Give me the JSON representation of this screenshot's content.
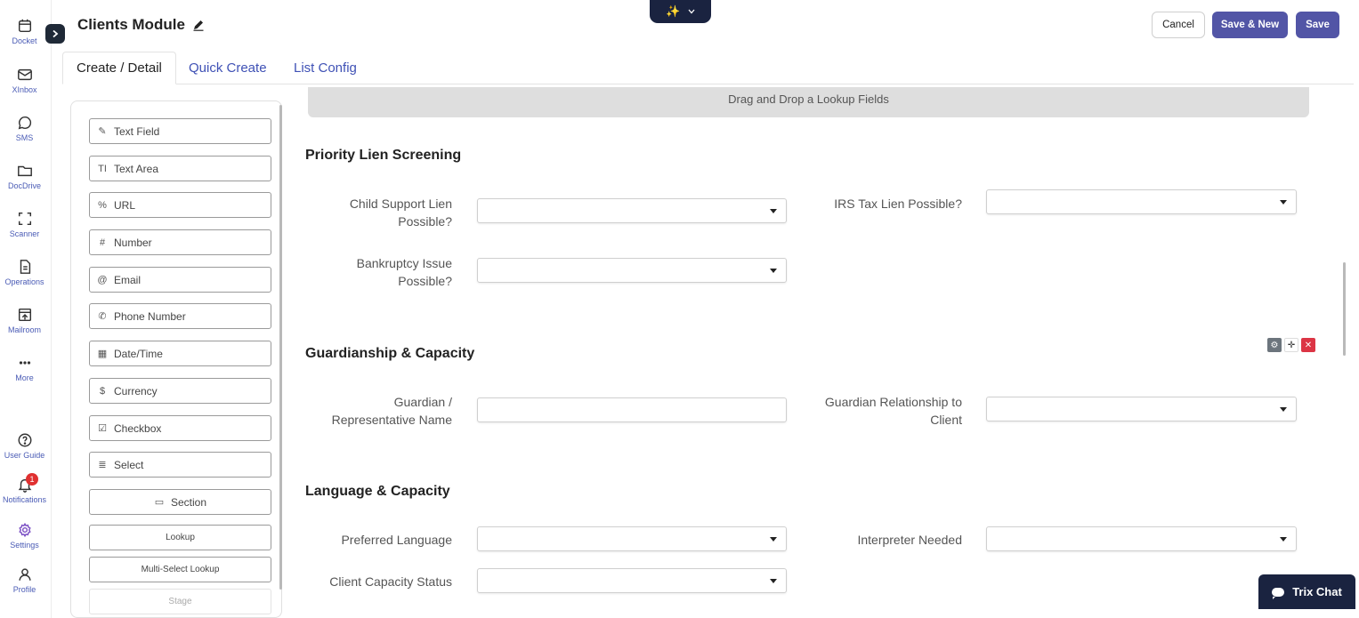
{
  "rail": {
    "items": [
      {
        "label": "Docket",
        "icon": "calendar-icon"
      },
      {
        "label": "XInbox",
        "icon": "mail-icon"
      },
      {
        "label": "SMS",
        "icon": "chat-bubble-icon"
      },
      {
        "label": "DocDrive",
        "icon": "folder-icon"
      },
      {
        "label": "Scanner",
        "icon": "scan-icon"
      },
      {
        "label": "Operations",
        "icon": "document-icon"
      },
      {
        "label": "Mailroom",
        "icon": "mailroom-icon"
      },
      {
        "label": "More",
        "icon": "more-dots-icon"
      }
    ],
    "bottom_items": [
      {
        "label": "User Guide",
        "icon": "help-circle-icon"
      },
      {
        "label": "Notifications",
        "icon": "bell-icon",
        "badge": "1"
      },
      {
        "label": "Settings",
        "icon": "gear-icon"
      },
      {
        "label": "Profile",
        "icon": "user-icon"
      }
    ]
  },
  "header": {
    "title": "Clients Module",
    "magic_icon": "✨",
    "cancel_label": "Cancel",
    "save_new_label": "Save & New",
    "save_label": "Save"
  },
  "tabs": [
    {
      "label": "Create / Detail",
      "active": true
    },
    {
      "label": "Quick Create",
      "active": false
    },
    {
      "label": "List Config",
      "active": false
    }
  ],
  "palette": {
    "items": [
      {
        "label": "Text Field",
        "icon": "✎"
      },
      {
        "label": "Text Area",
        "icon": "TI"
      },
      {
        "label": "URL",
        "icon": "%"
      },
      {
        "label": "Number",
        "icon": "#"
      },
      {
        "label": "Email",
        "icon": "@"
      },
      {
        "label": "Phone Number",
        "icon": "✆"
      },
      {
        "label": "Date/Time",
        "icon": "▦"
      },
      {
        "label": "Currency",
        "icon": "$"
      },
      {
        "label": "Checkbox",
        "icon": "☑"
      },
      {
        "label": "Select",
        "icon": "≣"
      },
      {
        "label": "Section",
        "icon": "▭"
      },
      {
        "label": "Lookup",
        "icon": ""
      },
      {
        "label": "Multi-Select Lookup",
        "icon": ""
      },
      {
        "label": "Stage",
        "icon": ""
      }
    ]
  },
  "form": {
    "dropzone_text": "Drag and Drop a Lookup Fields",
    "sections": [
      {
        "title": "Priority Lien Screening",
        "fields": [
          {
            "label": "Child Support Lien Possible?",
            "type": "select",
            "value": ""
          },
          {
            "label": "IRS Tax Lien Possible?",
            "type": "select",
            "value": ""
          },
          {
            "label": "Bankruptcy Issue Possible?",
            "type": "select",
            "value": ""
          }
        ]
      },
      {
        "title": "Guardianship & Capacity",
        "fields": [
          {
            "label": "Guardian / Representative Name",
            "type": "text",
            "value": ""
          },
          {
            "label": "Guardian Relationship to Client",
            "type": "select",
            "value": ""
          }
        ]
      },
      {
        "title": "Language & Capacity",
        "fields": [
          {
            "label": "Preferred Language",
            "type": "select",
            "value": ""
          },
          {
            "label": "Interpreter Needed",
            "type": "select",
            "value": ""
          },
          {
            "label": "Client Capacity Status",
            "type": "select",
            "value": ""
          }
        ]
      }
    ]
  },
  "chat": {
    "label": "Trix Chat"
  }
}
